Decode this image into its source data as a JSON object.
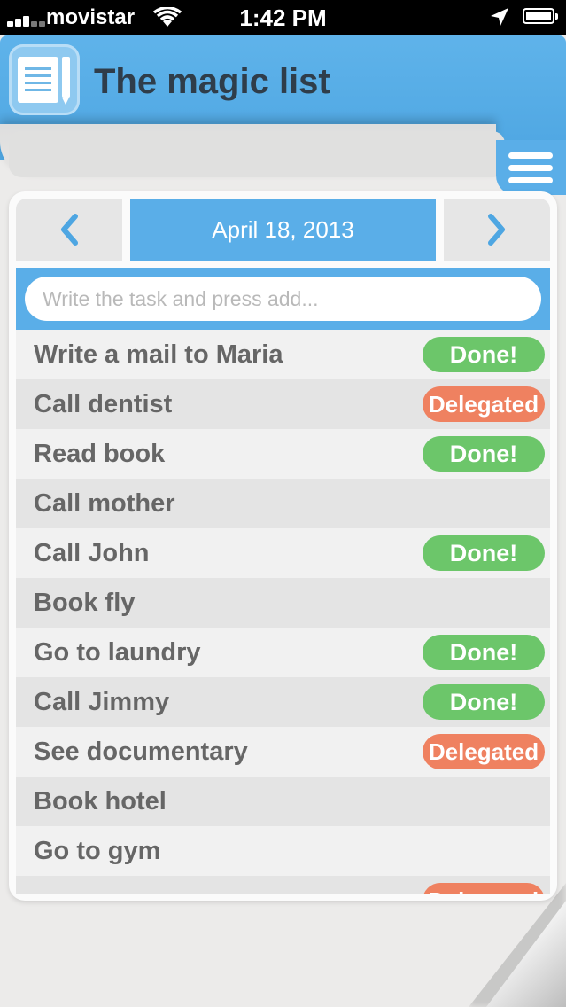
{
  "status_bar": {
    "carrier": "movistar",
    "time": "1:42 PM"
  },
  "header": {
    "title": "The magic list",
    "accent_color": "#5aaee8"
  },
  "date_nav": {
    "date": "April 18, 2013",
    "prev_glyph": "‹",
    "next_glyph": "›"
  },
  "add_task": {
    "placeholder": "Write the task and press add..."
  },
  "tasks": [
    {
      "label": "Write a mail to Maria",
      "status": "Done!"
    },
    {
      "label": "Call dentist",
      "status": "Delegated"
    },
    {
      "label": "Read book",
      "status": "Done!"
    },
    {
      "label": "Call mother",
      "status": ""
    },
    {
      "label": "Call John",
      "status": "Done!"
    },
    {
      "label": "Book fly",
      "status": ""
    },
    {
      "label": "Go to laundry",
      "status": "Done!"
    },
    {
      "label": "Call Jimmy",
      "status": "Done!"
    },
    {
      "label": "See documentary",
      "status": "Delegated"
    },
    {
      "label": "Book hotel",
      "status": ""
    },
    {
      "label": "Go to gym",
      "status": ""
    },
    {
      "label": "",
      "status": "Delegated"
    }
  ],
  "status_colors": {
    "done": "#6cc66a",
    "delegated": "#ef8160"
  }
}
